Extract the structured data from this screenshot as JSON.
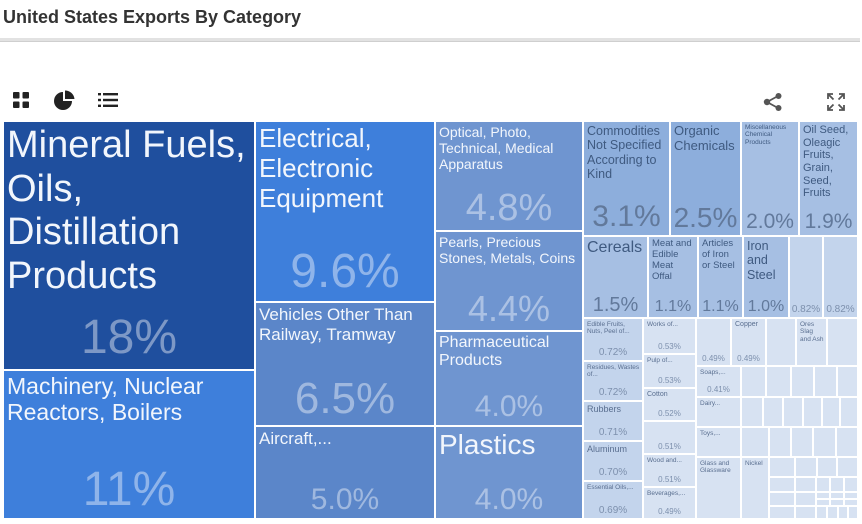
{
  "header": {
    "title": "United States Exports By Category"
  },
  "toolbar": {
    "icons": [
      "grid-view-icon",
      "pie-chart-icon",
      "list-view-icon",
      "share-icon",
      "expand-icon"
    ]
  },
  "colors": {
    "darkest": "#1f4f9e",
    "dark": "#3e7fdb",
    "mid": "#5b86c9",
    "midlight": "#6f95d0",
    "light": "#8daedc",
    "lighter": "#a6bfe3",
    "lightest": "#c3d4ec",
    "tiny": "#d7e2f2"
  },
  "chart_data": {
    "type": "treemap",
    "title": "United States Exports By Category",
    "unit": "% of total exports",
    "items": [
      {
        "label": "Mineral Fuels, Oils, Distillation Products",
        "value": 18,
        "value_label": "18%",
        "col": [
          0,
          252
        ],
        "row": [
          0,
          249
        ],
        "tone": "darkest",
        "fs": 38,
        "vs": 48
      },
      {
        "label": "Machinery, Nuclear Reactors, Boilers",
        "value": 11,
        "value_label": "11%",
        "col": [
          0,
          252
        ],
        "row": [
          249,
          398
        ],
        "tone": "dark",
        "fs": 23,
        "vs": 48
      },
      {
        "label": "Electrical, Electronic Equipment",
        "value": 9.6,
        "value_label": "9.6%",
        "col": [
          252,
          432
        ],
        "row": [
          0,
          181
        ],
        "tone": "dark",
        "fs": 26,
        "vs": 48
      },
      {
        "label": "Vehicles Other Than Railway, Tramway",
        "value": 6.5,
        "value_label": "6.5%",
        "col": [
          252,
          432
        ],
        "row": [
          181,
          305
        ],
        "tone": "mid",
        "fs": 17,
        "vs": 44
      },
      {
        "label": "Aircraft,...",
        "value": 5.0,
        "value_label": "5.0%",
        "col": [
          252,
          432
        ],
        "row": [
          305,
          398
        ],
        "tone": "mid",
        "fs": 17,
        "vs": 30
      },
      {
        "label": "Optical, Photo, Technical, Medical Apparatus",
        "value": 4.8,
        "value_label": "4.8%",
        "col": [
          432,
          580
        ],
        "row": [
          0,
          110
        ],
        "tone": "midlight",
        "fs": 14,
        "vs": 38
      },
      {
        "label": "Pearls, Precious Stones, Metals, Coins",
        "value": 4.4,
        "value_label": "4.4%",
        "col": [
          432,
          580
        ],
        "row": [
          110,
          210
        ],
        "tone": "midlight",
        "fs": 14,
        "vs": 36
      },
      {
        "label": "Pharmaceutical Products",
        "value": 4.0,
        "value_label": "4.0%",
        "col": [
          432,
          580
        ],
        "row": [
          210,
          305
        ],
        "tone": "midlight",
        "fs": 16,
        "vs": 30
      },
      {
        "label": "Plastics",
        "value": 4.0,
        "value_label": "4.0%",
        "col": [
          432,
          580
        ],
        "row": [
          305,
          398
        ],
        "tone": "midlight",
        "fs": 28,
        "vs": 30
      },
      {
        "label": "Commodities Not Specified According to Kind",
        "value": 3.1,
        "value_label": "3.1%",
        "col": [
          580,
          667
        ],
        "row": [
          0,
          115
        ],
        "tone": "light",
        "fs": 12.5,
        "vs": 30
      },
      {
        "label": "Organic Chemicals",
        "value": 2.5,
        "value_label": "2.5%",
        "col": [
          667,
          738
        ],
        "row": [
          0,
          115
        ],
        "tone": "light",
        "fs": 13,
        "vs": 28
      },
      {
        "label": "Miscellaneous Chemical Products",
        "value": 2.0,
        "value_label": "2.0%",
        "col": [
          738,
          796
        ],
        "row": [
          0,
          115
        ],
        "tone": "lighter",
        "fs": 6.5,
        "vs": 21
      },
      {
        "label": "Oil Seed, Oleagic Fruits, Grain, Seed, Fruits",
        "value": 1.9,
        "value_label": "1.9%",
        "col": [
          796,
          855
        ],
        "row": [
          0,
          115
        ],
        "tone": "lighter",
        "fs": 11,
        "vs": 21
      },
      {
        "label": "Cereals",
        "value": 1.5,
        "value_label": "1.5%",
        "col": [
          580,
          645
        ],
        "row": [
          115,
          197
        ],
        "tone": "lighter",
        "fs": 16,
        "vs": 20
      },
      {
        "label": "Meat and Edible Meat Offal",
        "value": 1.1,
        "value_label": "1.1%",
        "col": [
          645,
          695
        ],
        "row": [
          115,
          197
        ],
        "tone": "lighter",
        "fs": 9.5,
        "vs": 16
      },
      {
        "label": "Articles of Iron or Steel",
        "value": 1.1,
        "value_label": "1.1%",
        "col": [
          695,
          740
        ],
        "row": [
          115,
          197
        ],
        "tone": "lighter",
        "fs": 9.5,
        "vs": 16
      },
      {
        "label": "Iron and Steel",
        "value": 1.0,
        "value_label": "1.0%",
        "col": [
          740,
          786
        ],
        "row": [
          115,
          197
        ],
        "tone": "lighter",
        "fs": 12.5,
        "vs": 16
      },
      {
        "label": "",
        "value": 0.82,
        "value_label": "0.82%",
        "col": [
          786,
          820
        ],
        "row": [
          115,
          197
        ],
        "tone": "lightest",
        "fs": 9,
        "vs": 10
      },
      {
        "label": "",
        "value": 0.82,
        "value_label": "0.82%",
        "col": [
          820,
          855
        ],
        "row": [
          115,
          197
        ],
        "tone": "lightest",
        "fs": 9,
        "vs": 10
      },
      {
        "label": "Edible Fruits, Nuts, Peel of...",
        "value": 0.72,
        "value_label": "0.72%",
        "col": [
          580,
          640
        ],
        "row": [
          197,
          240
        ],
        "tone": "lightest",
        "fs": 6.5,
        "vs": 10
      },
      {
        "label": "Residues, Wastes of...",
        "value": 0.72,
        "value_label": "0.72%",
        "col": [
          580,
          640
        ],
        "row": [
          240,
          280
        ],
        "tone": "lightest",
        "fs": 6.5,
        "vs": 10
      },
      {
        "label": "Rubbers",
        "value": 0.71,
        "value_label": "0.71%",
        "col": [
          580,
          640
        ],
        "row": [
          280,
          320
        ],
        "tone": "lightest",
        "fs": 9,
        "vs": 10
      },
      {
        "label": "Aluminum",
        "value": 0.7,
        "value_label": "0.70%",
        "col": [
          580,
          640
        ],
        "row": [
          320,
          360
        ],
        "tone": "lightest",
        "fs": 9,
        "vs": 10
      },
      {
        "label": "Essential Oils,...",
        "value": 0.69,
        "value_label": "0.69%",
        "col": [
          580,
          640
        ],
        "row": [
          360,
          398
        ],
        "tone": "lightest",
        "fs": 6.5,
        "vs": 10
      },
      {
        "label": "Works of...",
        "value": 0.53,
        "value_label": "0.53%",
        "col": [
          640,
          693
        ],
        "row": [
          197,
          233
        ],
        "tone": "tiny",
        "fs": 6.5,
        "vs": 8
      },
      {
        "label": "Pulp of...",
        "value": 0.53,
        "value_label": "0.53%",
        "col": [
          640,
          693
        ],
        "row": [
          233,
          267
        ],
        "tone": "tiny",
        "fs": 6.5,
        "vs": 8
      },
      {
        "label": "Cotton",
        "value": 0.52,
        "value_label": "0.52%",
        "col": [
          640,
          693
        ],
        "row": [
          267,
          300
        ],
        "tone": "tiny",
        "fs": 7,
        "vs": 8
      },
      {
        "label": "",
        "value": 0.51,
        "value_label": "0.51%",
        "col": [
          640,
          693
        ],
        "row": [
          300,
          333
        ],
        "tone": "tiny",
        "fs": 6.5,
        "vs": 8
      },
      {
        "label": "Wood and...",
        "value": 0.51,
        "value_label": "0.51%",
        "col": [
          640,
          693
        ],
        "row": [
          333,
          366
        ],
        "tone": "tiny",
        "fs": 6.5,
        "vs": 8
      },
      {
        "label": "Beverages,...",
        "value": 0.49,
        "value_label": "0.49%",
        "col": [
          640,
          693
        ],
        "row": [
          366,
          398
        ],
        "tone": "tiny",
        "fs": 6.5,
        "vs": 8
      },
      {
        "label": "",
        "value": 0.49,
        "value_label": "0.49%",
        "col": [
          693,
          728
        ],
        "row": [
          197,
          245
        ],
        "tone": "tiny",
        "fs": 6.5,
        "vs": 8
      },
      {
        "label": "Copper",
        "value": 0.49,
        "value_label": "0.49%",
        "col": [
          728,
          763
        ],
        "row": [
          197,
          245
        ],
        "tone": "tiny",
        "fs": 7,
        "vs": 8
      },
      {
        "label": "Ores Slag and Ash",
        "value": 0,
        "value_label": "",
        "col": [
          793,
          824
        ],
        "row": [
          197,
          245
        ],
        "tone": "tiny",
        "fs": 6.5,
        "vs": 8
      },
      {
        "label": "Soaps,...",
        "value": 0.41,
        "value_label": "0.41%",
        "col": [
          693,
          738
        ],
        "row": [
          245,
          276
        ],
        "tone": "tiny",
        "fs": 6.5,
        "vs": 8
      },
      {
        "label": "Dairy...",
        "value": 0,
        "value_label": "",
        "col": [
          693,
          738
        ],
        "row": [
          276,
          306
        ],
        "tone": "tiny",
        "fs": 6.5,
        "vs": 8
      },
      {
        "label": "Toys,...",
        "value": 0,
        "value_label": "",
        "col": [
          693,
          738
        ],
        "row": [
          306,
          336
        ],
        "tone": "tiny",
        "fs": 6.5,
        "vs": 8
      },
      {
        "label": "Glass and Glassware",
        "value": 0,
        "value_label": "",
        "col": [
          693,
          738
        ],
        "row": [
          336,
          398
        ],
        "tone": "tiny",
        "fs": 6.5,
        "vs": 8
      },
      {
        "label": "Nickel",
        "value": 0,
        "value_label": "",
        "col": [
          738,
          766
        ],
        "row": [
          336,
          398
        ],
        "tone": "tiny",
        "fs": 6.5,
        "vs": 8
      }
    ]
  }
}
